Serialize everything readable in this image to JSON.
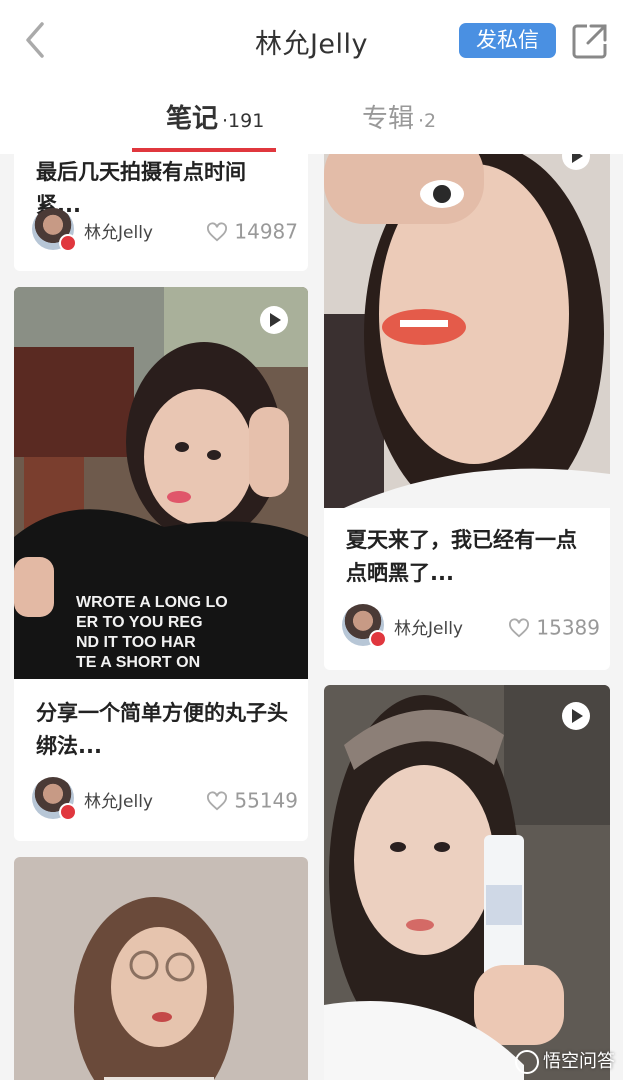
{
  "header": {
    "title": "林允Jelly",
    "message_button": "发私信"
  },
  "tabs": [
    {
      "label": "笔记",
      "count": "·191",
      "active": true
    },
    {
      "label": "专辑",
      "count": "·2",
      "active": false
    }
  ],
  "colors": {
    "accent_red": "#e0373e",
    "button_blue": "#4a90e2"
  },
  "notes": [
    {
      "caption": "最后几天拍摄有点时间紧...",
      "author": "林允Jelly",
      "likes": "14987",
      "video": false
    },
    {
      "caption": "",
      "author": "",
      "likes": "",
      "video": true
    },
    {
      "caption": "分享一个简单方便的丸子头绑法...",
      "author": "林允Jelly",
      "likes": "55149",
      "video": true
    },
    {
      "caption": "夏天来了，我已经有一点点晒黑了...",
      "author": "林允Jelly",
      "likes": "15389",
      "video": true
    },
    {
      "caption": "",
      "author": "",
      "likes": "",
      "video": false
    },
    {
      "caption": "",
      "author": "",
      "likes": "",
      "video": true
    }
  ],
  "icons": {
    "back": "chevron-left-icon",
    "share": "share-icon",
    "like": "heart-icon",
    "play": "play-icon"
  },
  "watermark": "悟空问答"
}
